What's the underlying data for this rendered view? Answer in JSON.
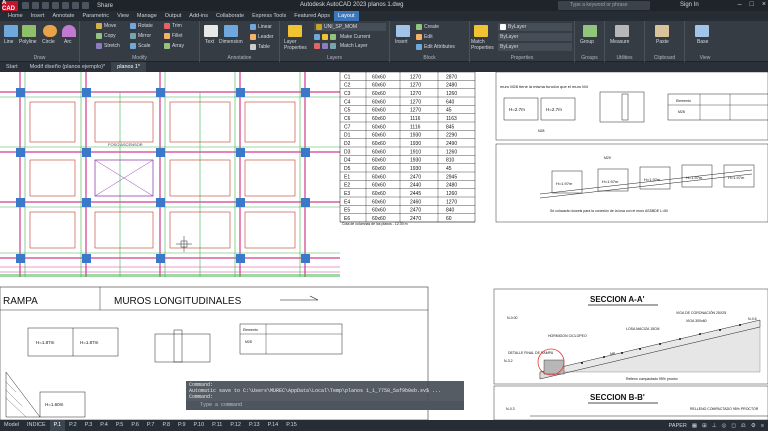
{
  "app": {
    "logo": "A CAD",
    "share": "Share",
    "title": "Autodesk AutoCAD 2023  planos 1.dwg",
    "search_placeholder": "Type a keyword or phrase",
    "signin": "Sign In"
  },
  "menu": [
    "Home",
    "Insert",
    "Annotate",
    "Parametric",
    "View",
    "Manage",
    "Output",
    "Add-ins",
    "Collaborate",
    "Express Tools",
    "Featured Apps",
    "Layout"
  ],
  "menu_active": 11,
  "ribbon": {
    "draw": {
      "title": "Draw",
      "line": "Line",
      "polyline": "Polyline",
      "circle": "Circle",
      "arc": "Arc"
    },
    "modify": {
      "title": "Modify",
      "move": "Move",
      "rotate": "Rotate",
      "trim": "Trim",
      "copy": "Copy",
      "mirror": "Mirror",
      "fillet": "Fillet",
      "stretch": "Stretch",
      "scale": "Scale",
      "array": "Array"
    },
    "annotation": {
      "title": "Annotation",
      "text": "Text",
      "dimension": "Dimension",
      "linear": "Linear",
      "leader": "Leader",
      "table": "Table"
    },
    "layers": {
      "title": "Layers",
      "layer_props": "Layer Properties",
      "current": "UNI_SP_MOM",
      "make_current": "Make Current",
      "match": "Match Layer"
    },
    "block": {
      "title": "Block",
      "insert": "Insert",
      "create": "Create",
      "edit": "Edit",
      "edit_attr": "Edit Attributes"
    },
    "properties": {
      "title": "Properties",
      "match": "Match Properties",
      "bylayer1": "ByLayer",
      "bylayer2": "ByLayer",
      "bylayer3": "ByLayer"
    },
    "groups": {
      "title": "Groups",
      "group": "Group"
    },
    "utilities": {
      "title": "Utilities",
      "measure": "Measure"
    },
    "clipboard": {
      "title": "Clipboard",
      "paste": "Paste"
    },
    "view": {
      "title": "View",
      "base": "Base"
    }
  },
  "doc_tabs": [
    "Start",
    "Modif diseño (planos ejemplo)*",
    "planos 1*"
  ],
  "doc_tab_active": 2,
  "drawing": {
    "table_rows": [
      [
        "C1",
        "60x60",
        "1270",
        "2870"
      ],
      [
        "C2",
        "60x60",
        "1270",
        "2480"
      ],
      [
        "C3",
        "60x60",
        "1270",
        "1260"
      ],
      [
        "C4",
        "60x60",
        "1270",
        "640"
      ],
      [
        "C5",
        "60x60",
        "1270",
        "45"
      ],
      [
        "C6",
        "60x60",
        "1116",
        "1163"
      ],
      [
        "C7",
        "60x60",
        "1116",
        "845"
      ],
      [
        "D1",
        "60x60",
        "1930",
        "2290"
      ],
      [
        "D2",
        "60x60",
        "1930",
        "2490"
      ],
      [
        "D3",
        "60x60",
        "1910",
        "1260"
      ],
      [
        "D4",
        "60x60",
        "1930",
        "810"
      ],
      [
        "D5",
        "60x60",
        "1930",
        "45"
      ],
      [
        "E1",
        "60x60",
        "2470",
        "2945"
      ],
      [
        "E2",
        "60x60",
        "2440",
        "2480"
      ],
      [
        "E3",
        "60x60",
        "2445",
        "1260"
      ],
      [
        "E4",
        "60x60",
        "2460",
        "1270"
      ],
      [
        "E5",
        "60x60",
        "2470",
        "840"
      ],
      [
        "E6",
        "60x60",
        "2470",
        "60"
      ]
    ],
    "table_note": "Cota de columnas de los planos - 12.00 m",
    "foso": "FOSO ASCENSOR",
    "rampa": "RAMPA",
    "muros": "MUROS LONGITUDINALES",
    "seccion_a": "SECCION  A-A'",
    "seccion_b": "SECCION  B-B'",
    "muro_note": "muro M28 tiene la misma función que el muro M4",
    "h27": "H=2.7m",
    "h197": "H=1.97m",
    "h187": "H=1.87m",
    "elem": "Elemento",
    "m28": "M28",
    "m29": "M29",
    "n28": "N28",
    "dowel_note": "Se colocarán dowels para la conexión de la losa con el muro  ASSBDE L=50",
    "hormigon": "HORMIGON CICLOPEO",
    "losa": "LOSA MACIZA 15CM",
    "viga300": "VIGA 300x60",
    "viga_cor": "VIGA DE CORONACIÓN 25X25",
    "detalle": "DETALLE FINAL DE RAMPA",
    "relleno": "Relleno compactado 95% proctor",
    "relleno2": "RELLENO COMPACTADO 95% PROCTOR",
    "n000": "N-0.00",
    "n32": "N-3.2",
    "n06": "N-0.6",
    "n03": "N-0.3",
    "m23": "M23",
    "mp": "MP",
    "h160": "H=1.60m"
  },
  "command": {
    "header": "Command:",
    "line1": "Automatic save to C:\\Users\\MUREC\\AppData\\Local\\Temp\\planos 1_1_7758_5af9b0eb.sv$ ...",
    "line2": "Command:",
    "placeholder": "Type a command"
  },
  "layouts": [
    "Model",
    "INDICE",
    "P.1",
    "P.2",
    "P.3",
    "P.4",
    "P.5",
    "P.6",
    "P.7",
    "P.8",
    "P.9",
    "P.10",
    "P.11",
    "P.12",
    "P.13",
    "P.14",
    "P.15"
  ],
  "layout_active": 2,
  "status": {
    "paper": "PAPER"
  }
}
